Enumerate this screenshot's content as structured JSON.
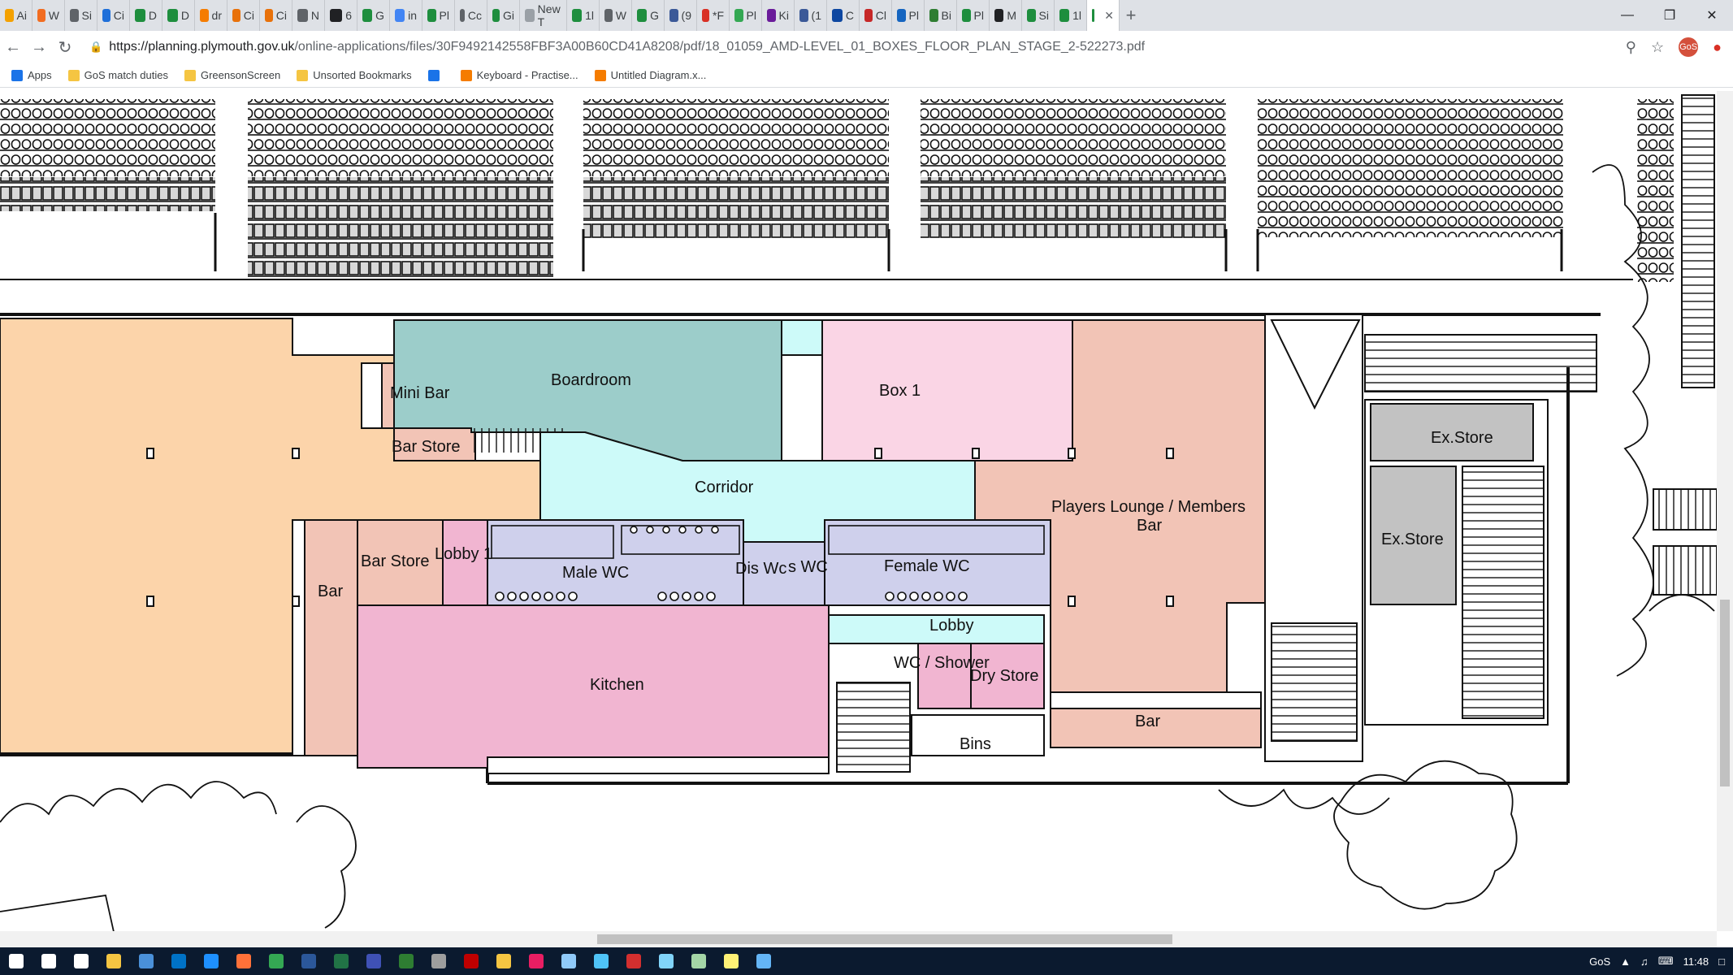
{
  "browser": {
    "tabs": [
      {
        "label": "Ai",
        "color": "#f4a100"
      },
      {
        "label": "W",
        "color": "#f26d21"
      },
      {
        "label": "Si",
        "color": "#5f6368"
      },
      {
        "label": "Ci",
        "color": "#1e6fd9"
      },
      {
        "label": "D",
        "color": "#1e8e3e"
      },
      {
        "label": "D",
        "color": "#1e8e3e"
      },
      {
        "label": "dr",
        "color": "#f57c00"
      },
      {
        "label": "Ci",
        "color": "#e8710a"
      },
      {
        "label": "Ci",
        "color": "#e8710a"
      },
      {
        "label": "N",
        "color": "#5f6368"
      },
      {
        "label": "6",
        "color": "#202124"
      },
      {
        "label": "G",
        "color": "#1e8e3e"
      },
      {
        "label": "in",
        "color": "#4285f4"
      },
      {
        "label": "Pl",
        "color": "#1e8e3e"
      },
      {
        "label": "Cc",
        "color": "#5f6368"
      },
      {
        "label": "Gi",
        "color": "#1e8e3e"
      },
      {
        "label": "New T",
        "color": "#9aa0a6"
      },
      {
        "label": "1l",
        "color": "#1e8e3e"
      },
      {
        "label": "W",
        "color": "#5f6368"
      },
      {
        "label": "G",
        "color": "#1e8e3e"
      },
      {
        "label": "(9",
        "color": "#3b5998"
      },
      {
        "label": "*F",
        "color": "#d93025"
      },
      {
        "label": "Pl",
        "color": "#34a853"
      },
      {
        "label": "Ki",
        "color": "#6a1b9a"
      },
      {
        "label": "(1",
        "color": "#3b5998"
      },
      {
        "label": "C",
        "color": "#0d47a1"
      },
      {
        "label": "Cl",
        "color": "#c62828"
      },
      {
        "label": "Pl",
        "color": "#1565c0"
      },
      {
        "label": "Bi",
        "color": "#2e7d32"
      },
      {
        "label": "Pl",
        "color": "#1e8e3e"
      },
      {
        "label": "M",
        "color": "#202124"
      },
      {
        "label": "Si",
        "color": "#1e8e3e"
      },
      {
        "label": "1l",
        "color": "#1e8e3e"
      },
      {
        "label": "",
        "color": "#1e8e3e",
        "active": true
      }
    ],
    "new_tab_symbol": "+",
    "window_controls": {
      "minimize": "—",
      "maximize": "❐",
      "close": "✕"
    },
    "url": {
      "host": "https://planning.plymouth.gov.uk",
      "path": "/online-applications/files/30F9492142558FBF3A00B60CD41A8208/pdf/18_01059_AMD-LEVEL_01_BOXES_FLOOR_PLAN_STAGE_2-522273.pdf"
    },
    "profile_initials": "GoS",
    "bookmarks": [
      {
        "label": "Apps",
        "icon": "apps-icon",
        "color": "#1a73e8"
      },
      {
        "label": "GoS match duties",
        "icon": "folder-icon",
        "color": "#f5c542"
      },
      {
        "label": "GreensonScreen",
        "icon": "folder-icon",
        "color": "#f5c542"
      },
      {
        "label": "Unsorted Bookmarks",
        "icon": "folder-icon",
        "color": "#f5c542"
      },
      {
        "label": "",
        "icon": "link-icon",
        "color": "#1a73e8"
      },
      {
        "label": "Keyboard - Practise...",
        "icon": "keyboard-icon",
        "color": "#f57c00"
      },
      {
        "label": "Untitled Diagram.x...",
        "icon": "diagram-icon",
        "color": "#f57c00"
      }
    ]
  },
  "floor_plan": {
    "rooms": {
      "mini_bar": "Mini Bar",
      "boardroom": "Boardroom",
      "bar_store_top": "Bar Store",
      "box_1": "Box 1",
      "corridor": "Corridor",
      "players_lounge_line1": "Players Lounge / Members",
      "players_lounge_line2": "Bar",
      "ex_store_1": "Ex.Store",
      "ex_store_2": "Ex.Store",
      "bar_store_bottom": "Bar Store",
      "lobby_1": "Lobby 1",
      "bar_left": "Bar",
      "male_wc": "Male WC",
      "dis_wc": "Dis Wc",
      "dis_wc_suffix": "s WC",
      "female_wc": "Female WC",
      "lobby": "Lobby",
      "wc_shower": "WC / Shower",
      "dry_store": "Dry Store",
      "kitchen": "Kitchen",
      "bins": "Bins",
      "bar_right": "Bar"
    },
    "colors": {
      "peach": "#fcd4aa",
      "teal": "#9ccdca",
      "pink_light": "#fad5e5",
      "salmon": "#f2c4b6",
      "cyan": "#cdfaf9",
      "lavender": "#cfd0ec",
      "pink": "#f1b5d1",
      "grey_store": "#c2c2c2"
    }
  },
  "taskbar": {
    "apps": [
      {
        "name": "windows-start-icon",
        "color": "#ffffff"
      },
      {
        "name": "search-icon",
        "color": "#ffffff"
      },
      {
        "name": "task-view-icon",
        "color": "#ffffff"
      },
      {
        "name": "file-explorer-icon",
        "color": "#f5c542"
      },
      {
        "name": "app-icon",
        "color": "#4a90d9"
      },
      {
        "name": "outlook-icon",
        "color": "#0072c6"
      },
      {
        "name": "edge-icon",
        "color": "#1e90ff"
      },
      {
        "name": "firefox-icon",
        "color": "#ff7139"
      },
      {
        "name": "chrome-icon",
        "color": "#34a853"
      },
      {
        "name": "app-icon",
        "color": "#2b579a"
      },
      {
        "name": "excel-icon",
        "color": "#217346"
      },
      {
        "name": "app-icon",
        "color": "#3f51b5"
      },
      {
        "name": "app-icon",
        "color": "#2e7d32"
      },
      {
        "name": "app-icon",
        "color": "#9e9e9e"
      },
      {
        "name": "filezilla-icon",
        "color": "#bf0000"
      },
      {
        "name": "app-icon",
        "color": "#f5c542"
      },
      {
        "name": "app-icon",
        "color": "#e91e63"
      },
      {
        "name": "app-icon",
        "color": "#90caf9"
      },
      {
        "name": "app-icon",
        "color": "#4fc3f7"
      },
      {
        "name": "acrobat-icon",
        "color": "#d32f2f"
      },
      {
        "name": "app-icon",
        "color": "#81d4fa"
      },
      {
        "name": "app-icon",
        "color": "#a5d6a7"
      },
      {
        "name": "app-icon",
        "color": "#fff176"
      },
      {
        "name": "app-icon",
        "color": "#64b5f6"
      }
    ],
    "tray_user": "GoS",
    "clock": "11:48"
  }
}
